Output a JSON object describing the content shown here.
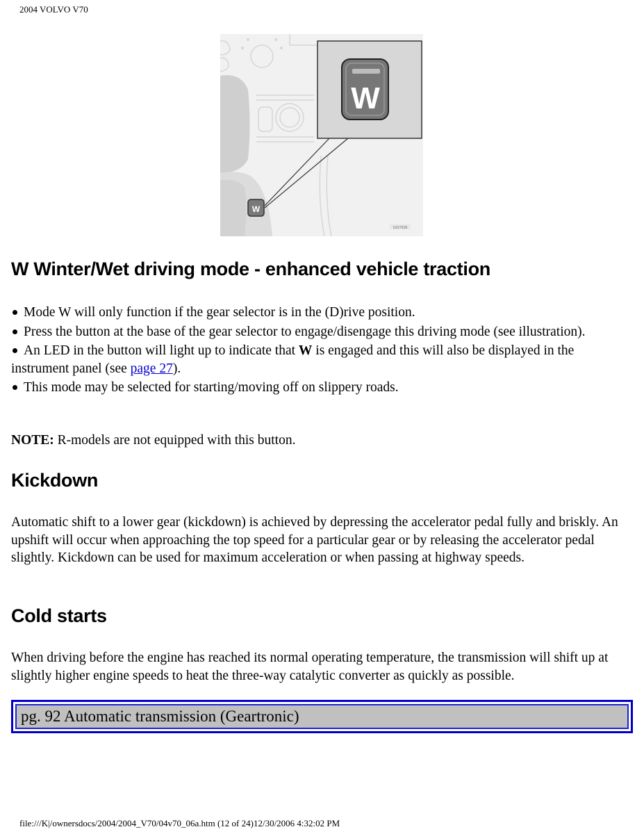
{
  "header": {
    "title": "2004 VOLVO V70"
  },
  "figure": {
    "caption_code": "G027838",
    "button_letter": "W",
    "description": "Gear selector area with W (Winter/Wet) mode button, enlarged inset"
  },
  "sections": {
    "winter": {
      "heading": "W Winter/Wet driving mode - enhanced vehicle traction",
      "bullets": [
        {
          "text": "Mode W will only function if the gear selector is in the (D)rive position."
        },
        {
          "text": "Press the button at the base of the gear selector to engage/disengage this driving mode (see illustration)."
        },
        {
          "text_before": "An LED in the button will light up to indicate that ",
          "bold": "W",
          "text_middle": " is engaged and this will also be displayed in the instrument panel (see ",
          "link": "page 27",
          "text_after": ")."
        },
        {
          "text": "This mode may be selected for starting/moving off on slippery roads."
        }
      ],
      "note_label": "NOTE:",
      "note_text": " R-models are not equipped with this button."
    },
    "kickdown": {
      "heading": "Kickdown",
      "paragraph": "Automatic shift to a lower gear (kickdown) is achieved by depressing the accelerator pedal fully and briskly. An upshift will occur when approaching the top speed for a particular gear or by releasing the accelerator pedal slightly. Kickdown can be used for maximum acceleration or when passing at highway speeds."
    },
    "cold_starts": {
      "heading": "Cold starts",
      "paragraph": "When driving before the engine has reached its normal operating temperature, the transmission will shift up at slightly higher engine speeds to heat the three-way catalytic converter as quickly as possible."
    }
  },
  "nav": {
    "label": "pg. 92 Automatic transmission (Geartronic)"
  },
  "footer": {
    "text": "file:///K|/ownersdocs/2004/2004_V70/04v70_06a.htm (12 of 24)12/30/2006 4:32:02 PM"
  },
  "colors": {
    "link": "#0000cc",
    "nav_border": "#0000cc",
    "nav_bg": "#c0c0c0"
  }
}
